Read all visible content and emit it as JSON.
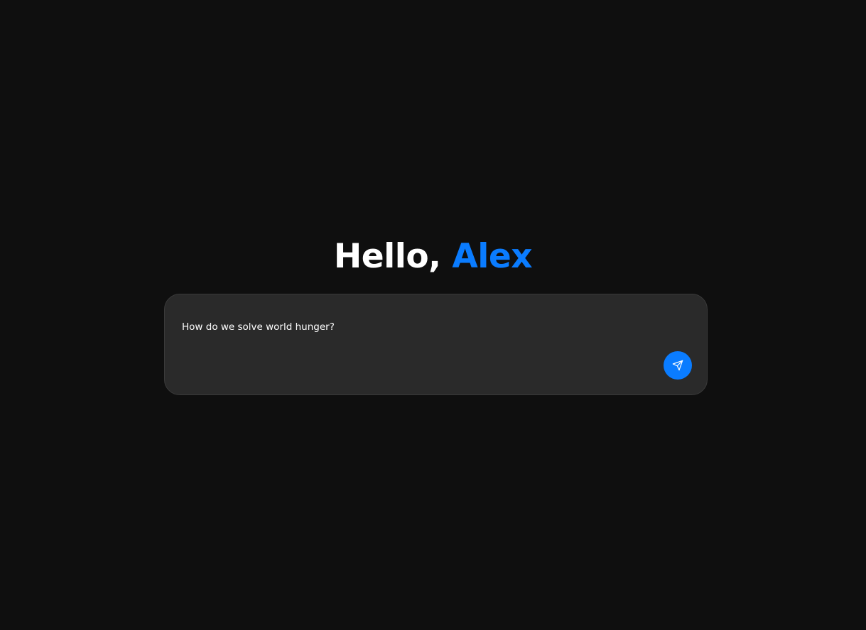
{
  "greeting": {
    "prefix": "Hello, ",
    "name": "Alex"
  },
  "composer": {
    "input_value": "How do we solve world hunger?",
    "send_icon": "send-icon"
  },
  "colors": {
    "background": "#0f0f0f",
    "accent": "#0a7cff",
    "composer_bg": "#2a2a2a"
  }
}
